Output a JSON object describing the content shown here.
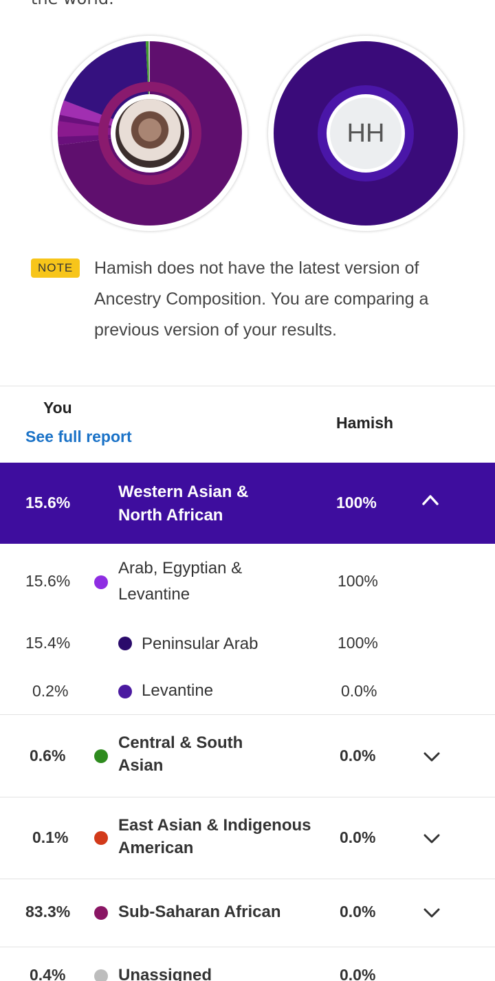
{
  "intro": {
    "text": "the world."
  },
  "comparison": {
    "you_photo_alt": "Your profile photo",
    "hamish_initials": "HH",
    "you_chart_colors": [
      "#5f0f6e",
      "#35117f",
      "#8a1a8e",
      "#a12fb1",
      "#3f9b2b",
      "#c8c8c8"
    ],
    "hamish_chart_color": "#3a0b7a"
  },
  "note": {
    "badge": "NOTE",
    "text": "Hamish does not have the latest version of Ancestry Composition. You are comparing a previous version of your results."
  },
  "table_header": {
    "you": "You",
    "see_full_report": "See full report",
    "hamish": "Hamish"
  },
  "expanded_group": {
    "you_pct": "15.6%",
    "name": "Western Asian & North African",
    "hamish_pct": "100%"
  },
  "subrows": [
    {
      "you_pct": "15.6%",
      "name": "Arab, Egyptian & Levantine",
      "hamish_pct": "100%",
      "color": "#8e2de2"
    },
    {
      "you_pct": "15.4%",
      "name": "Peninsular Arab",
      "hamish_pct": "100%",
      "color": "#2a0a6b"
    },
    {
      "you_pct": "0.2%",
      "name": "Levantine",
      "hamish_pct": "0.0%",
      "color": "#4b1aa0"
    }
  ],
  "groups": [
    {
      "you_pct": "0.6%",
      "name": "Central & South Asian",
      "hamish_pct": "0.0%",
      "color": "#2e8b1e"
    },
    {
      "you_pct": "0.1%",
      "name": "East Asian & Indigenous American",
      "hamish_pct": "0.0%",
      "color": "#d23a1a"
    },
    {
      "you_pct": "83.3%",
      "name": "Sub-Saharan African",
      "hamish_pct": "0.0%",
      "color": "#8a1664"
    },
    {
      "you_pct": "0.4%",
      "name": "Unassigned",
      "hamish_pct": "0.0%",
      "color": "#bdbdbd"
    }
  ]
}
